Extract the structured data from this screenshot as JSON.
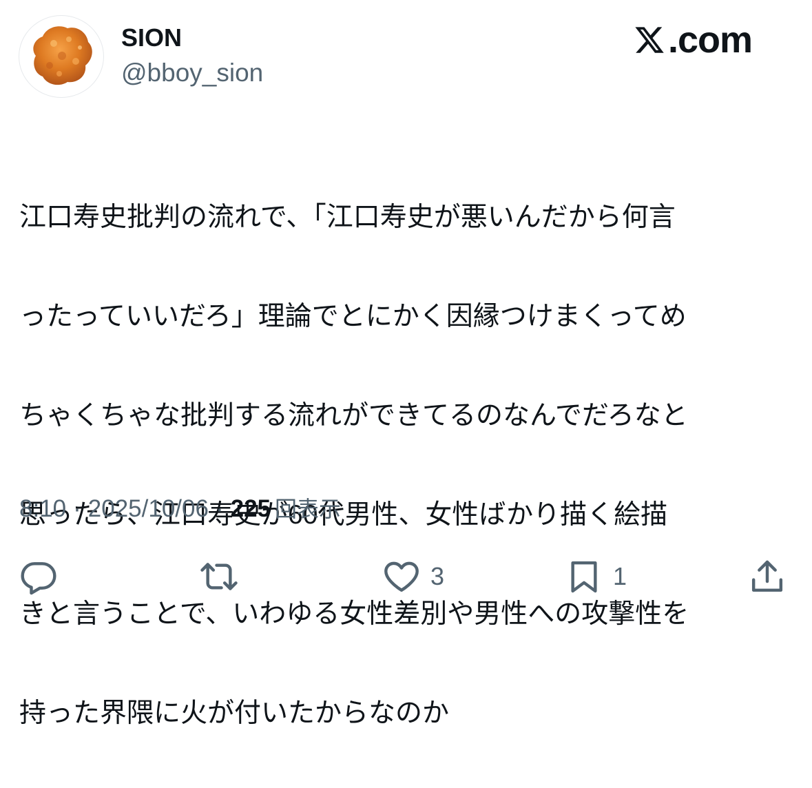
{
  "profile": {
    "display_name": "SION",
    "handle": "@bboy_sion"
  },
  "brand": {
    "text": ".com",
    "icon": "x-logo-icon"
  },
  "tweet": {
    "lines": [
      "江口寿史批判の流れで、「江口寿史が悪いんだから何言",
      "ったっていいだろ」理論でとにかく因縁つけまくってめ",
      "ちゃくちゃな批判する流れができてるのなんでだろなと",
      "思ったら、江口寿史が60代男性、女性ばかり描く絵描",
      "きと言うことで、いわゆる女性差別や男性への攻撃性を",
      "持った界隈に火が付いたからなのか"
    ]
  },
  "meta": {
    "time": "8:10",
    "separator": "·",
    "date": "2025/10/06",
    "views_count": "225",
    "views_label": "回表示"
  },
  "actions": {
    "reply": {
      "icon": "reply-icon",
      "count": ""
    },
    "repost": {
      "icon": "repost-icon",
      "count": ""
    },
    "like": {
      "icon": "heart-icon",
      "count": "3"
    },
    "bookmark": {
      "icon": "bookmark-icon",
      "count": "1"
    },
    "share": {
      "icon": "share-icon",
      "count": ""
    }
  },
  "colors": {
    "text_primary": "#0f1419",
    "text_secondary": "#536471",
    "background": "#ffffff"
  }
}
